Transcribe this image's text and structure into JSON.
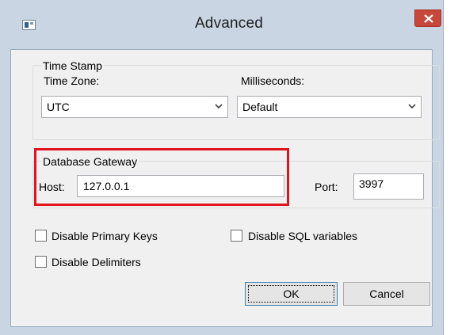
{
  "window": {
    "title": "Advanced",
    "icon": "window-app-icon",
    "close_icon": "close-x-icon"
  },
  "timestamp_group": {
    "legend": "Time Stamp",
    "timezone_label": "Time Zone:",
    "timezone_value": "UTC",
    "milliseconds_label": "Milliseconds:",
    "milliseconds_value": "Default"
  },
  "gateway_group": {
    "legend": "Database Gateway",
    "host_label": "Host:",
    "host_value": "127.0.0.1",
    "port_label": "Port:",
    "port_value": "3997",
    "highlight_color": "#e0141e"
  },
  "options": {
    "disable_primary_keys": {
      "label": "Disable Primary Keys",
      "checked": false
    },
    "disable_sql_variables": {
      "label": "Disable SQL variables",
      "checked": false
    },
    "disable_delimiters": {
      "label": "Disable Delimiters",
      "checked": false
    }
  },
  "buttons": {
    "ok": "OK",
    "cancel": "Cancel"
  }
}
